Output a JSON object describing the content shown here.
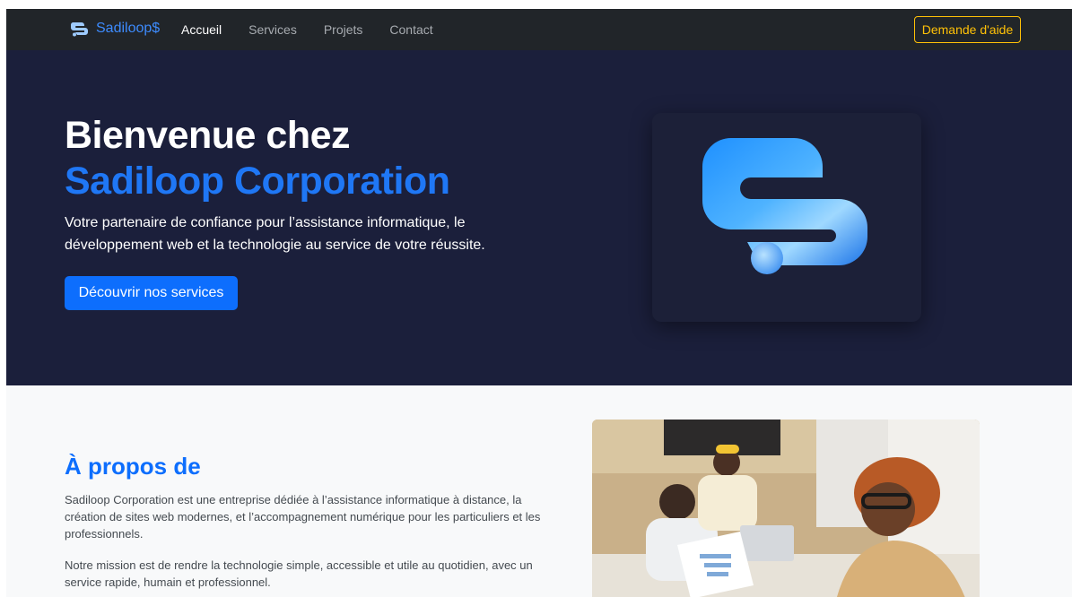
{
  "nav": {
    "brand": "Sadiloop$",
    "links": [
      {
        "label": "Accueil",
        "active": true
      },
      {
        "label": "Services",
        "active": false
      },
      {
        "label": "Projets",
        "active": false
      },
      {
        "label": "Contact",
        "active": false
      }
    ],
    "help_button": "Demande d'aide"
  },
  "hero": {
    "title_line1": "Bienvenue chez",
    "title_line2": "Sadiloop Corporation",
    "description": "Votre partenaire de confiance pour l’assistance informatique, le développement web et la technologie au service de votre réussite.",
    "cta": "Découvrir nos services"
  },
  "about": {
    "title": "À propos de",
    "paragraph1": "Sadiloop Corporation est une entreprise dédiée à l’assistance informatique à distance, la création de sites web modernes, et l’accompagnement numérique pour les particuliers et les professionnels.",
    "paragraph2": "Notre mission est de rendre la technologie simple, accessible et utile au quotidien, avec un service rapide, humain et professionnel."
  },
  "colors": {
    "navbar_bg": "#212529",
    "hero_bg": "#1b1f3b",
    "accent_blue": "#0d6efd",
    "help_yellow": "#ffc107",
    "about_bg": "#f8f9fa"
  },
  "icons": {
    "brand": "sadiloop-logo-icon",
    "hero_logo": "sadiloop-logo-large"
  }
}
